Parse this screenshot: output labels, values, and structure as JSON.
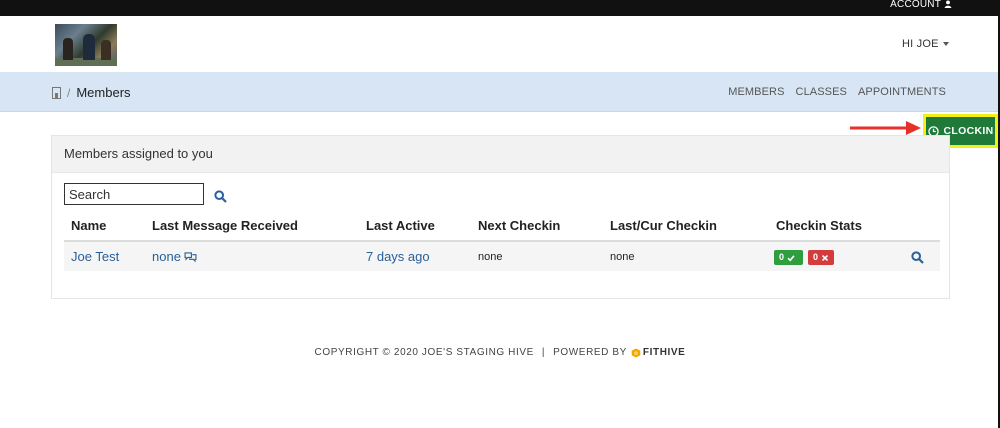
{
  "topbar": {
    "account_label": "ACCOUNT"
  },
  "header": {
    "user_greeting": "HI JOE"
  },
  "breadcrumb": {
    "current": "Members",
    "separator": "/"
  },
  "nav": {
    "items": [
      "MEMBERS",
      "CLASSES",
      "APPOINTMENTS"
    ]
  },
  "clockin": {
    "label": "CLOCKIN"
  },
  "panel": {
    "title": "Members assigned to you",
    "search_placeholder": "Search"
  },
  "table": {
    "columns": [
      "Name",
      "Last Message Received",
      "Last Active",
      "Next Checkin",
      "Last/Cur Checkin",
      "Checkin Stats"
    ],
    "rows": [
      {
        "name": "Joe Test",
        "last_message": "none",
        "last_active": "7 days ago",
        "next_checkin": "none",
        "last_cur_checkin": "none",
        "stats_ok": "0",
        "stats_missed": "0"
      }
    ]
  },
  "footer": {
    "copyright": "COPYRIGHT © 2020 JOE'S STAGING HIVE",
    "separator": "|",
    "powered_by": "POWERED BY",
    "brand": "FITHIVE"
  },
  "colors": {
    "accent_green": "#1f7a3a",
    "highlight_yellow": "#f3ef18",
    "nav_band": "#d7e5f5",
    "link_blue": "#2a6099",
    "arrow_red": "#e8302a",
    "badge_ok": "#2e9e3e",
    "badge_missed": "#d33c3c"
  },
  "icons": {
    "account": "user-icon",
    "home": "home-icon",
    "clock": "clock-icon",
    "search": "search-icon",
    "chat": "chat-icon",
    "check": "check-icon",
    "times": "times-icon",
    "brand": "hexagon-icon"
  }
}
